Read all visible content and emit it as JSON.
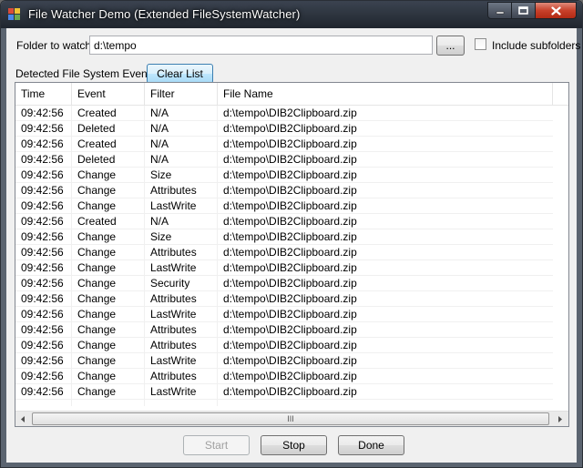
{
  "window": {
    "title": "File Watcher Demo (Extended FileSystemWatcher)",
    "icon": "app-window-icon",
    "caption_buttons": [
      "minimize-icon",
      "maximize-icon",
      "close-icon"
    ]
  },
  "folder": {
    "label": "Folder to watch",
    "value": "d:\\tempo",
    "browse_label": "...",
    "include_subfolders_label": "Include subfolders",
    "include_subfolders_checked": false
  },
  "events": {
    "label": "Detected File System Events",
    "clear_label": "Clear List",
    "columns": [
      "Time",
      "Event",
      "Filter",
      "File Name"
    ],
    "rows": [
      [
        "09:42:56",
        "Created",
        "N/A",
        "d:\\tempo\\DIB2Clipboard.zip"
      ],
      [
        "09:42:56",
        "Deleted",
        "N/A",
        "d:\\tempo\\DIB2Clipboard.zip"
      ],
      [
        "09:42:56",
        "Created",
        "N/A",
        "d:\\tempo\\DIB2Clipboard.zip"
      ],
      [
        "09:42:56",
        "Deleted",
        "N/A",
        "d:\\tempo\\DIB2Clipboard.zip"
      ],
      [
        "09:42:56",
        "Change",
        "Size",
        "d:\\tempo\\DIB2Clipboard.zip"
      ],
      [
        "09:42:56",
        "Change",
        "Attributes",
        "d:\\tempo\\DIB2Clipboard.zip"
      ],
      [
        "09:42:56",
        "Change",
        "LastWrite",
        "d:\\tempo\\DIB2Clipboard.zip"
      ],
      [
        "09:42:56",
        "Created",
        "N/A",
        "d:\\tempo\\DIB2Clipboard.zip"
      ],
      [
        "09:42:56",
        "Change",
        "Size",
        "d:\\tempo\\DIB2Clipboard.zip"
      ],
      [
        "09:42:56",
        "Change",
        "Attributes",
        "d:\\tempo\\DIB2Clipboard.zip"
      ],
      [
        "09:42:56",
        "Change",
        "LastWrite",
        "d:\\tempo\\DIB2Clipboard.zip"
      ],
      [
        "09:42:56",
        "Change",
        "Security",
        "d:\\tempo\\DIB2Clipboard.zip"
      ],
      [
        "09:42:56",
        "Change",
        "Attributes",
        "d:\\tempo\\DIB2Clipboard.zip"
      ],
      [
        "09:42:56",
        "Change",
        "LastWrite",
        "d:\\tempo\\DIB2Clipboard.zip"
      ],
      [
        "09:42:56",
        "Change",
        "Attributes",
        "d:\\tempo\\DIB2Clipboard.zip"
      ],
      [
        "09:42:56",
        "Change",
        "Attributes",
        "d:\\tempo\\DIB2Clipboard.zip"
      ],
      [
        "09:42:56",
        "Change",
        "LastWrite",
        "d:\\tempo\\DIB2Clipboard.zip"
      ],
      [
        "09:42:56",
        "Change",
        "Attributes",
        "d:\\tempo\\DIB2Clipboard.zip"
      ],
      [
        "09:42:56",
        "Change",
        "LastWrite",
        "d:\\tempo\\DIB2Clipboard.zip"
      ]
    ],
    "scroll_grip": "III"
  },
  "footer": {
    "start_label": "Start",
    "start_enabled": false,
    "stop_label": "Stop",
    "done_label": "Done"
  },
  "colors": {
    "titlebar": "#2b323c",
    "client_bg": "#f0f0f0",
    "focus_border": "#3c7fb1",
    "close_red": "#c8402a"
  }
}
